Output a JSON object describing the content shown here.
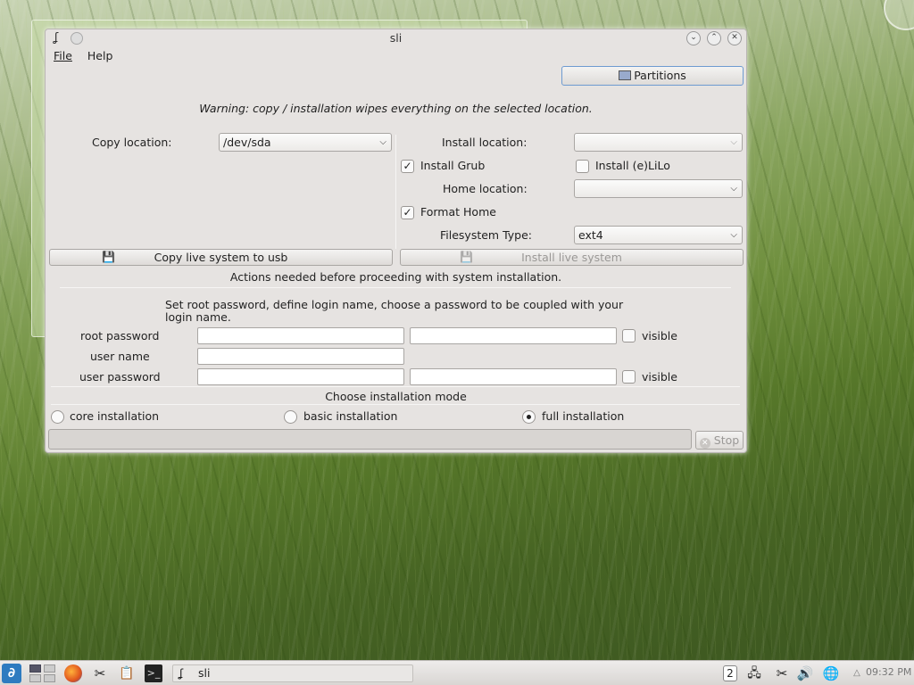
{
  "window": {
    "title": "sli"
  },
  "menu": {
    "file": "File",
    "help": "Help"
  },
  "partitions_button": "Partitions",
  "warning": "Warning: copy / installation wipes everything on the selected location.",
  "copy": {
    "location_label": "Copy location:",
    "location_value": "/dev/sda",
    "button": "Copy live system to usb"
  },
  "install": {
    "location_label": "Install location:",
    "location_value": "",
    "grub_label": "Install Grub",
    "grub_checked": true,
    "lilo_label": "Install (e)LiLo",
    "lilo_checked": false,
    "home_label": "Home location:",
    "home_value": "",
    "format_home_label": "Format Home",
    "format_home_checked": true,
    "fs_label": "Filesystem Type:",
    "fs_value": "ext4",
    "button": "Install live system"
  },
  "actions_needed": "Actions needed before proceeding with system installation.",
  "instructions": "Set root password, define login name, choose a password to be coupled with your login name.",
  "fields": {
    "root_password": "root password",
    "user_name": "user name",
    "user_password": "user password",
    "visible": "visible"
  },
  "mode": {
    "heading": "Choose installation mode",
    "options": [
      "core installation",
      "basic installation",
      "full installation"
    ],
    "selected": "full installation"
  },
  "stop_button": "Stop",
  "taskbar": {
    "task_label": "sli",
    "desktop_number": "2",
    "clock": "09:32 PM"
  }
}
